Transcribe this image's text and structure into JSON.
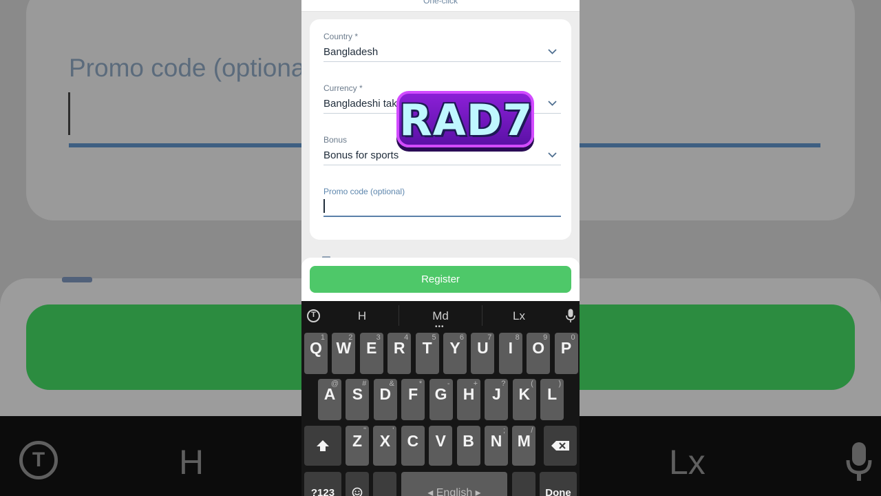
{
  "background": {
    "promo_label": "Promo code (optiona",
    "suggestion_h": "H",
    "suggestion_lx": "Lx"
  },
  "topbar": {
    "label": "One-click"
  },
  "form": {
    "country": {
      "label": "Country *",
      "value": "Bangladesh"
    },
    "currency": {
      "label": "Currency *",
      "value": "Bangladeshi taka"
    },
    "bonus": {
      "label": "Bonus",
      "value": "Bonus for sports"
    },
    "promo": {
      "label": "Promo code (optional)",
      "value": ""
    }
  },
  "register_label": "Register",
  "keyboard": {
    "suggestions": [
      "H",
      "Md",
      "Lx"
    ],
    "suggestion_dots": "•••",
    "translate_icon_letter": "T",
    "row1": [
      {
        "k": "Q",
        "h": "1"
      },
      {
        "k": "W",
        "h": "2"
      },
      {
        "k": "E",
        "h": "3"
      },
      {
        "k": "R",
        "h": "4"
      },
      {
        "k": "T",
        "h": "5"
      },
      {
        "k": "Y",
        "h": "6"
      },
      {
        "k": "U",
        "h": "7"
      },
      {
        "k": "I",
        "h": "8"
      },
      {
        "k": "O",
        "h": "9"
      },
      {
        "k": "P",
        "h": "0"
      }
    ],
    "row2": [
      {
        "k": "A",
        "h": "@"
      },
      {
        "k": "S",
        "h": "#"
      },
      {
        "k": "D",
        "h": "&"
      },
      {
        "k": "F",
        "h": "*"
      },
      {
        "k": "G",
        "h": "-"
      },
      {
        "k": "H",
        "h": "+"
      },
      {
        "k": "J",
        "h": "?"
      },
      {
        "k": "K",
        "h": "("
      },
      {
        "k": "L",
        "h": ")"
      }
    ],
    "row3": [
      {
        "k": "Z",
        "h": "\""
      },
      {
        "k": "X",
        "h": "'"
      },
      {
        "k": "C",
        "h": ""
      },
      {
        "k": "V",
        "h": ""
      },
      {
        "k": "B",
        "h": ""
      },
      {
        "k": "N",
        "h": ";"
      },
      {
        "k": "M",
        "h": "/"
      }
    ],
    "symbols_label": "?123",
    "space_label": "◂ English ▸",
    "done_label": "Done"
  },
  "overlay": {
    "text": "RAD7"
  }
}
